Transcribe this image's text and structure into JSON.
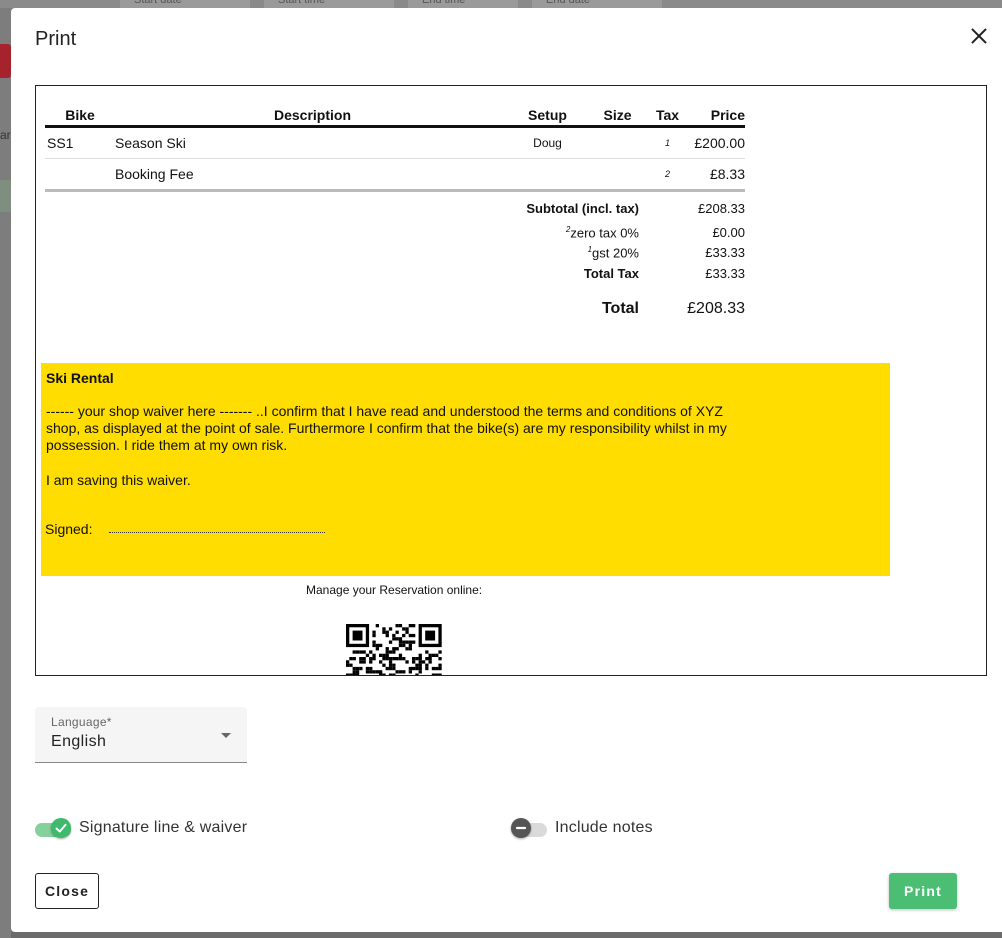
{
  "background": {
    "fields": [
      "Start date",
      "Start time",
      "End time",
      "End date"
    ],
    "left_partial_text": "ar"
  },
  "dialog": {
    "title": "Print",
    "close_icon": "close-icon"
  },
  "invoice": {
    "columns": [
      "Bike",
      "Description",
      "Setup",
      "Size",
      "Tax",
      "Price"
    ],
    "rows": [
      {
        "bike": "SS1",
        "description": "Season Ski",
        "setup": "Doug",
        "size": "",
        "tax": "1",
        "price": "£200.00"
      },
      {
        "bike": "",
        "description": "Booking Fee",
        "setup": "",
        "size": "",
        "tax": "2",
        "price": "£8.33"
      }
    ],
    "subtotal_label": "Subtotal (incl. tax)",
    "subtotal_value": "£208.33",
    "tax_lines": [
      {
        "marker": "2",
        "label": "zero tax 0%",
        "value": "£0.00"
      },
      {
        "marker": "1",
        "label": "gst 20%",
        "value": "£33.33"
      }
    ],
    "total_tax_label": "Total Tax",
    "total_tax_value": "£33.33",
    "total_label": "Total",
    "total_value": "£208.33"
  },
  "waiver": {
    "title": "Ski Rental",
    "body": "------ your shop waiver here ------- ..I confirm that I have read and understood the terms and conditions of XYZ shop, as displayed at the point of sale. Furthermore I confirm that the bike(s) are my responsibility whilst in my possession. I ride them at my own risk.",
    "saving": "I am saving this waiver.",
    "signed_label": "Signed:",
    "background_color": "#ffdd00"
  },
  "manage_text": "Manage your Reservation online:",
  "language": {
    "label": "Language*",
    "value": "English"
  },
  "toggles": {
    "signature": {
      "label": "Signature line & waiver",
      "on": true
    },
    "notes": {
      "label": "Include notes",
      "on": false
    }
  },
  "buttons": {
    "close": "Close",
    "print": "Print"
  },
  "colors": {
    "accent_green": "#4cbe74",
    "toggle_on_track": "#86d09b"
  }
}
